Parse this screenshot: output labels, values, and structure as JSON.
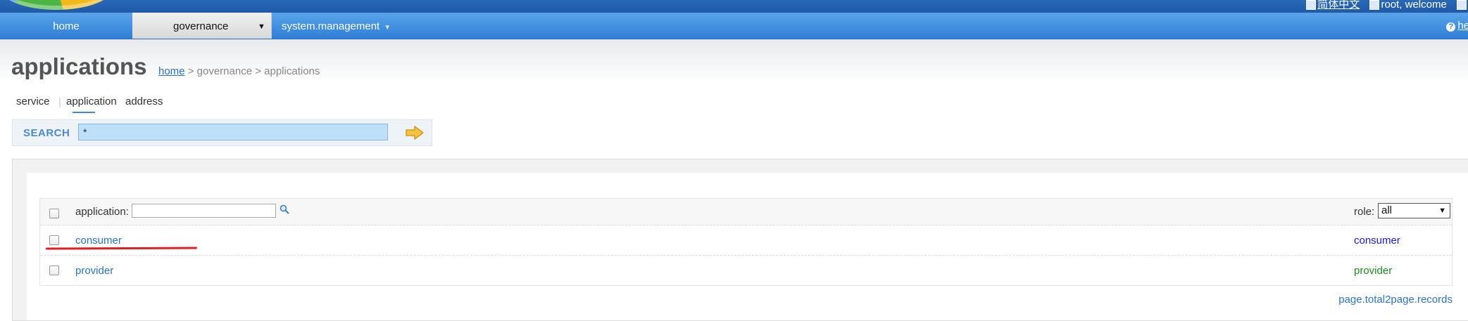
{
  "topbar": {
    "lang_link": "简体中文",
    "welcome": "root, welcome"
  },
  "nav": {
    "home": "home",
    "governance": "governance",
    "system": "system.management",
    "help": "he"
  },
  "page": {
    "title": "applications",
    "breadcrumb": {
      "home": "home",
      "sep1": " > ",
      "governance": "governance",
      "sep2": " > ",
      "current": "applications"
    }
  },
  "subtabs": [
    "service",
    "application",
    "address"
  ],
  "search": {
    "label": "SEARCH",
    "value": "*"
  },
  "table": {
    "filter_label": "application:",
    "role_label": "role:",
    "role_selected": "all",
    "rows": [
      {
        "name": "consumer",
        "role": "consumer",
        "role_color": "#1a1adb"
      },
      {
        "name": "provider",
        "role": "provider",
        "role_color": "#1e8a1e"
      }
    ]
  },
  "pager": "page.total2page.records",
  "colors": {
    "nav": "#2e7fd6",
    "link": "#2b73c6",
    "highlight": "#e02020"
  }
}
